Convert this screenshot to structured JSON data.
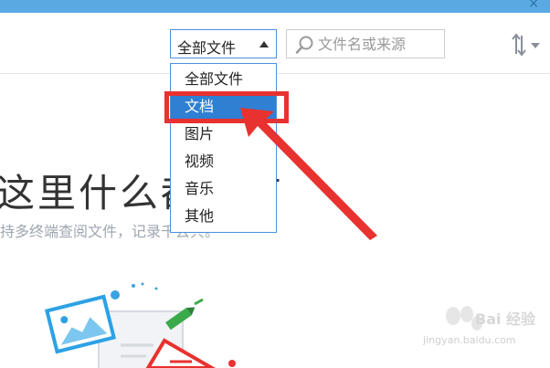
{
  "window": {
    "close_glyph": "×"
  },
  "filter": {
    "selected": "全部文件",
    "options": [
      "全部文件",
      "文档",
      "图片",
      "视频",
      "音乐",
      "其他"
    ],
    "highlighted": "文档"
  },
  "search": {
    "placeholder": "文件名或来源"
  },
  "empty_state": {
    "title": "这里什么都没有",
    "subtitle": "持多终端查阅文件，记录千去共。"
  },
  "watermark": {
    "logo_text": "Bai 经验",
    "url": "jingyan.baidu.com"
  },
  "colors": {
    "accent": "#4a90e2",
    "selected_bg": "#2f7fd3",
    "annotation": "#e8322f",
    "titlebar": "#5aa9e3"
  }
}
